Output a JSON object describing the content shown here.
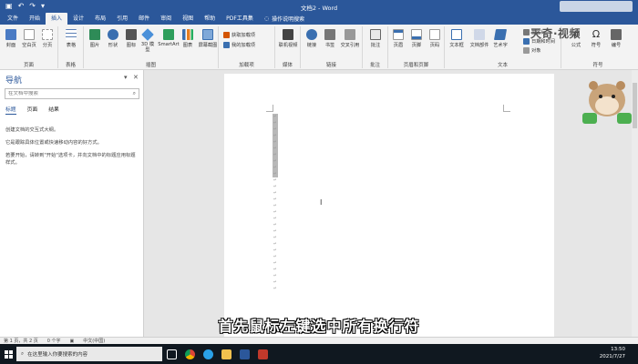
{
  "titlebar": {
    "doc_title": "文档2 - Word",
    "save_icon": "save-icon",
    "undo_icon": "undo-icon",
    "redo_icon": "redo-icon"
  },
  "tabs": [
    "文件",
    "开始",
    "插入",
    "设计",
    "布局",
    "引用",
    "邮件",
    "审阅",
    "视图",
    "帮助",
    "PDF工具集"
  ],
  "active_tab": "插入",
  "tell_me": "操作说明搜索",
  "ribbon": {
    "groups": [
      "页面",
      "表格",
      "插图",
      "加载项",
      "媒体",
      "链接",
      "批注",
      "页眉和页脚",
      "文本",
      "符号"
    ],
    "buttons": {
      "cover": "封面",
      "blank_page": "空白页",
      "page_break": "分页",
      "table": "表格",
      "picture": "图片",
      "shapes": "形状",
      "icons": "图标",
      "model3d": "3D 模型",
      "smartart": "SmartArt",
      "chart": "图表",
      "screenshot": "屏幕截图",
      "get_addins": "获取加载项",
      "my_addins": "我的加载项",
      "online_video": "联机视频",
      "link": "链接",
      "bookmark": "书签",
      "cross_ref": "交叉引用",
      "comment": "批注",
      "header": "页眉",
      "footer": "页脚",
      "page_number": "页码",
      "textbox": "文本框",
      "doc_parts": "文档部件",
      "wordart": "艺术字",
      "signature": "签名行",
      "datetime": "日期和时间",
      "object": "对象",
      "equation": "公式",
      "symbol": "符号",
      "numbering": "编号"
    },
    "brand": "天奇·视频"
  },
  "nav": {
    "title": "导航",
    "search_placeholder": "在文档中搜索",
    "tabs": [
      "标题",
      "页面",
      "结果"
    ],
    "active_tab": "标题",
    "text1": "创建文档的交互式大纲。",
    "text2": "它是跟踪具体位置或快速移动内容的好方式。",
    "text3": "若要开始，请转到\"开始\"选项卡，并向文档中的标题应用标题样式。"
  },
  "subtitle": "首先鼠标左键选中所有换行符",
  "status": {
    "page": "第 1 页，共 2 页",
    "words": "0 个字",
    "lang": "中文(中国)"
  },
  "taskbar": {
    "search_placeholder": "在这里输入你要搜索的内容",
    "time": "13:50",
    "date": "2021/7/27"
  },
  "colors": {
    "word_blue": "#2b579a",
    "ribbon_bg": "#f3f3f3",
    "taskbar_bg": "#101820"
  }
}
